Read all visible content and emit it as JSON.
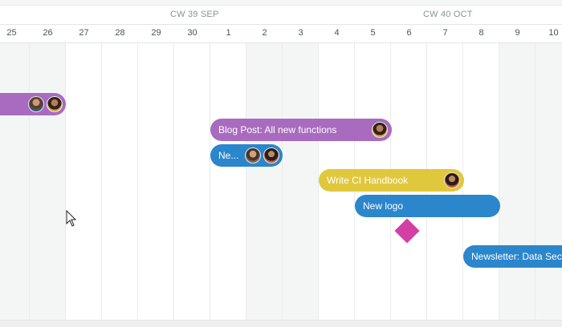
{
  "header": {
    "weeks": [
      {
        "label": "CW 39 SEP"
      },
      {
        "label": "CW 40 OCT"
      }
    ],
    "days": [
      "25",
      "26",
      "27",
      "28",
      "29",
      "30",
      "1",
      "2",
      "3",
      "4",
      "5",
      "6",
      "7",
      "8",
      "9",
      "10"
    ],
    "weekend_days": [
      "25",
      "26",
      "2",
      "3",
      "9",
      "10"
    ]
  },
  "tasks": [
    {
      "label": "",
      "color": "#a86bbf",
      "avatars": [
        "avatar-person",
        "avatar-person"
      ]
    },
    {
      "label": "Blog Post: All new functions",
      "color": "#a86bbf",
      "avatars": [
        "avatar-person"
      ]
    },
    {
      "label": "Ne...",
      "color": "#2b86cc",
      "avatars": [
        "avatar-person",
        "avatar-person"
      ]
    },
    {
      "label": "Write CI Handbook",
      "color": "#e0c83c",
      "avatars": [
        "avatar-person"
      ]
    },
    {
      "label": "New logo",
      "color": "#2b86cc",
      "avatars": []
    },
    {
      "label": "Newsletter: Data Sec...",
      "color": "#2b86cc",
      "avatars": []
    }
  ],
  "milestone": {
    "icon": "diamond-milestone-icon",
    "color": "#d43fa5"
  },
  "cursor": {
    "icon": "mouse-pointer-icon"
  }
}
